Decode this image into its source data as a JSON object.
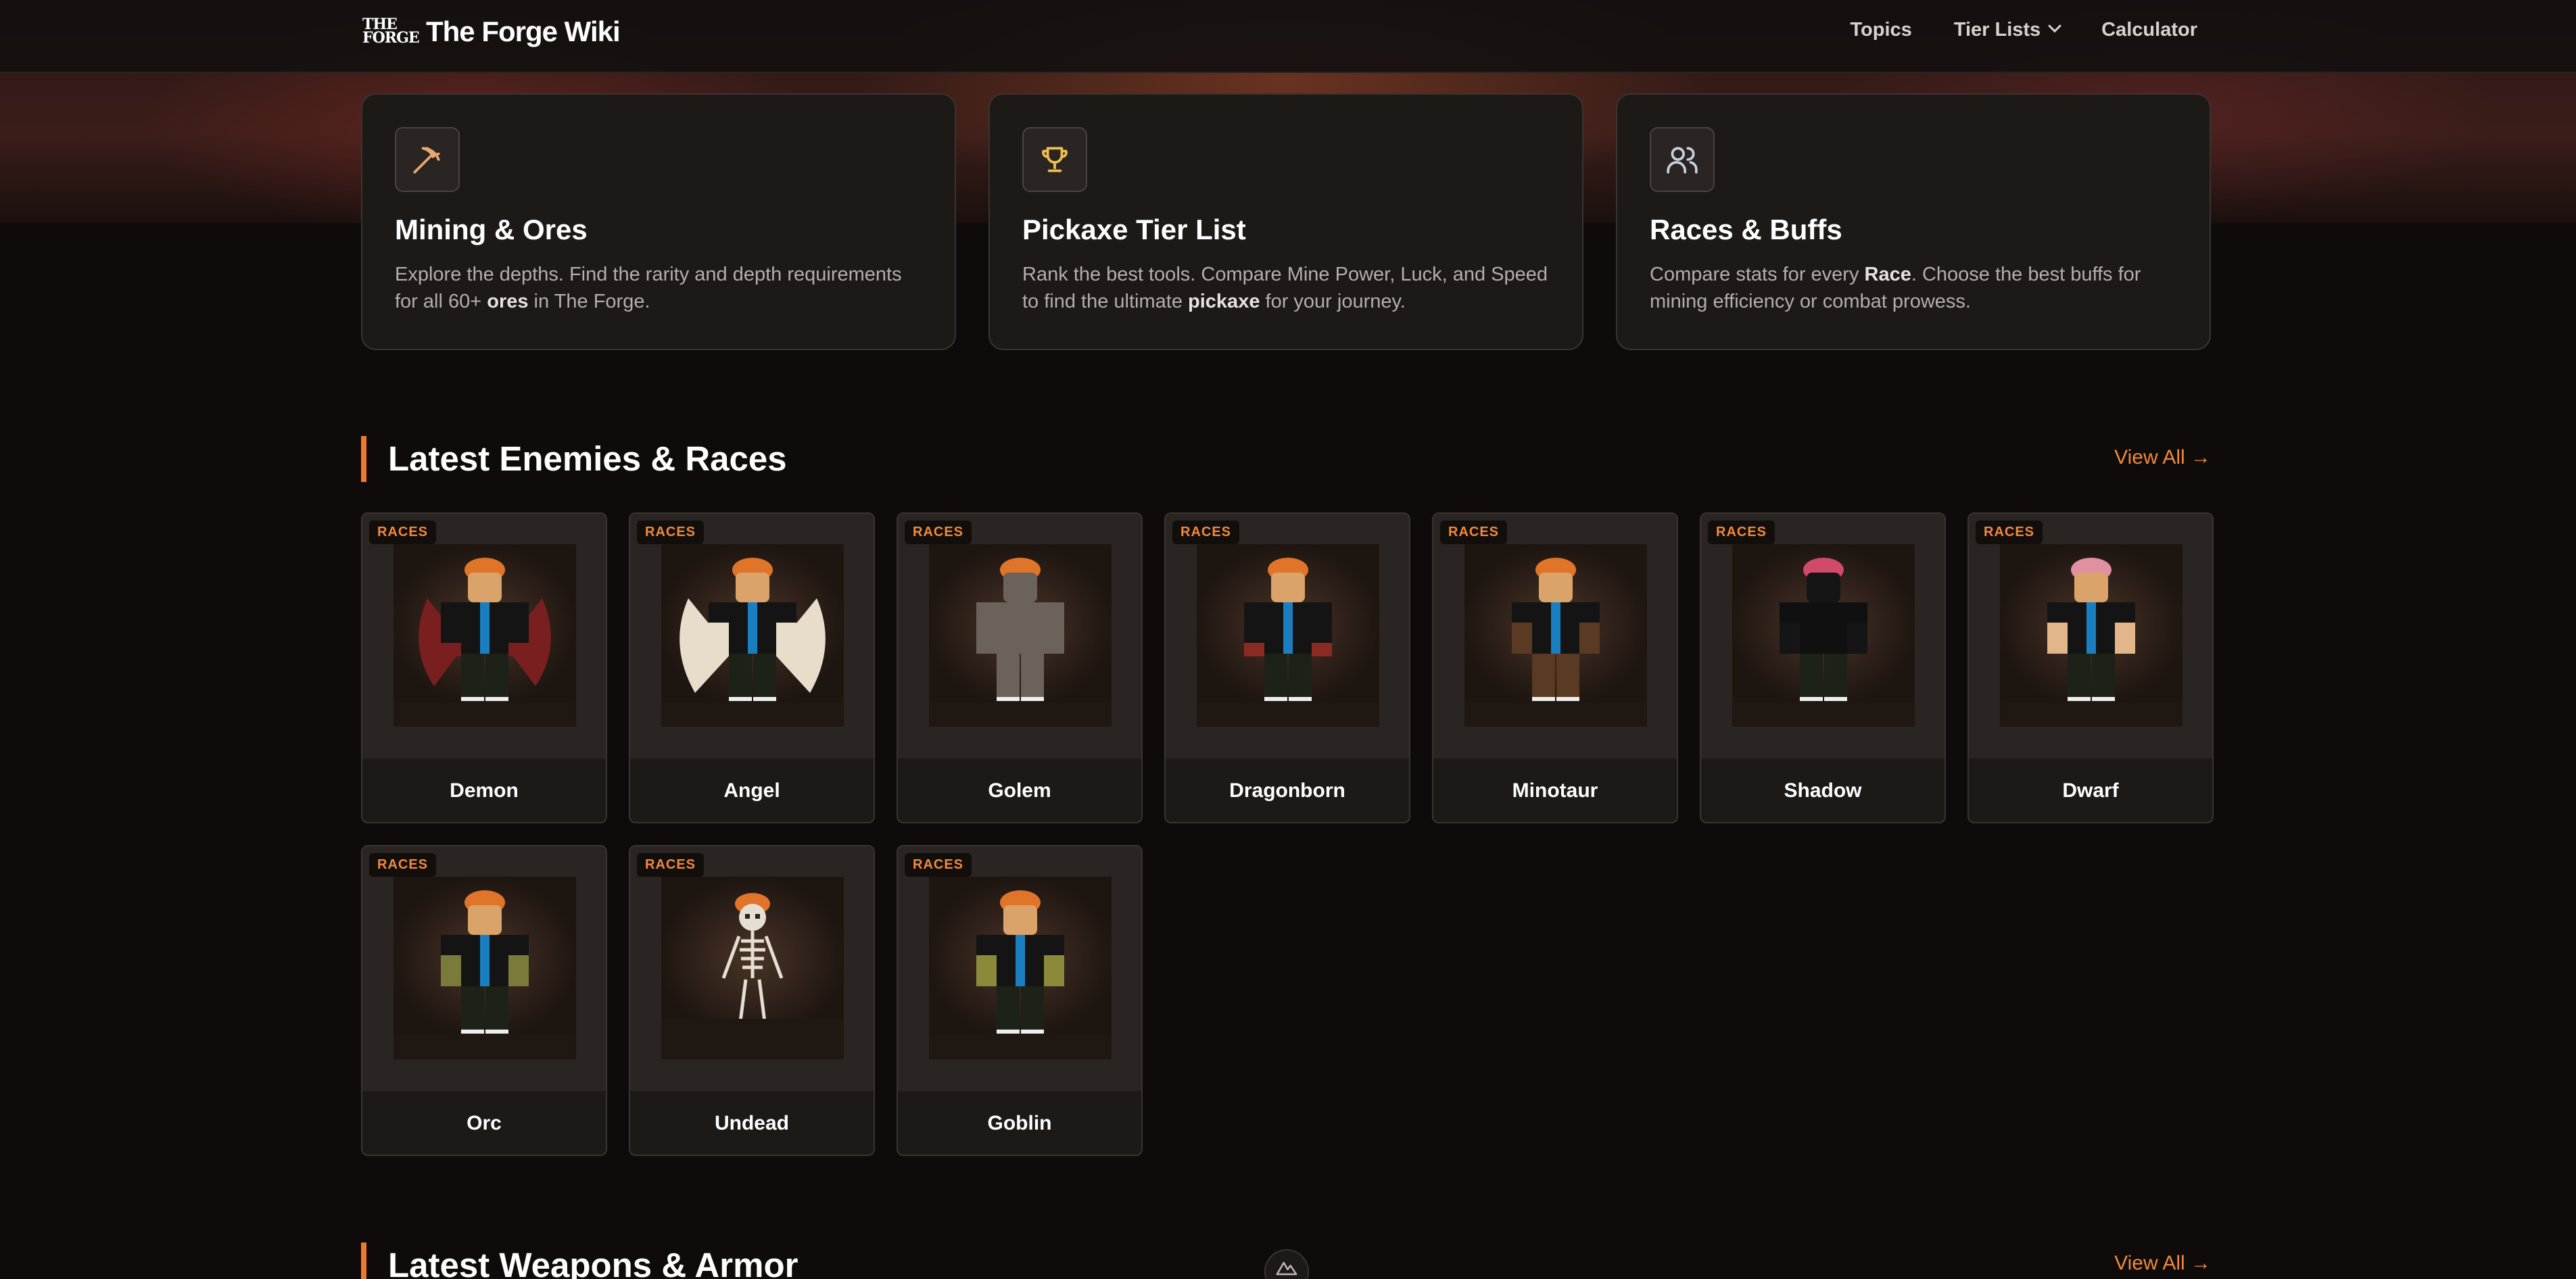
{
  "header": {
    "logo_mark_line1": "THE",
    "logo_mark_line2": "FORGE",
    "site_title": "The Forge Wiki",
    "nav": {
      "topics": "Topics",
      "tier_lists": "Tier Lists",
      "calculator": "Calculator"
    }
  },
  "features": [
    {
      "icon": "pickaxe-icon",
      "title": "Mining & Ores",
      "desc_before": "Explore the depths. Find the rarity and depth requirements for all 60+ ",
      "desc_bold": "ores",
      "desc_after": " in The Forge."
    },
    {
      "icon": "trophy-icon",
      "title": "Pickaxe Tier List",
      "desc_before": "Rank the best tools. Compare Mine Power, Luck, and Speed to find the ultimate ",
      "desc_bold": "pickaxe",
      "desc_after": " for your journey."
    },
    {
      "icon": "users-icon",
      "title": "Races & Buffs",
      "desc_before": "Compare stats for every ",
      "desc_bold": "Race",
      "desc_after": ". Choose the best buffs for mining efficiency or combat prowess."
    }
  ],
  "enemies_section": {
    "title": "Latest Enemies & Races",
    "view_all": "View All →",
    "badge": "RACES",
    "cards": [
      {
        "name": "Demon",
        "shirt": "#141414",
        "skin": "#6b2a2a",
        "hair": "#e0752a",
        "accent": "#7a1f1f"
      },
      {
        "name": "Angel",
        "shirt": "#141414",
        "skin": "#d9a36a",
        "hair": "#e0752a",
        "accent": "#e8dccb"
      },
      {
        "name": "Golem",
        "shirt": "#6b625a",
        "skin": "#6b625a",
        "hair": "#e0752a",
        "accent": "#6b625a"
      },
      {
        "name": "Dragonborn",
        "shirt": "#141414",
        "skin": "#8a2a22",
        "hair": "#e0752a",
        "accent": "#8a2a22"
      },
      {
        "name": "Minotaur",
        "shirt": "#141414",
        "skin": "#d9a36a",
        "hair": "#e0752a",
        "accent": "#5a3a22"
      },
      {
        "name": "Shadow",
        "shirt": "#101010",
        "skin": "#151515",
        "hair": "#d04a6a",
        "accent": "#151515"
      },
      {
        "name": "Dwarf",
        "shirt": "#141414",
        "skin": "#e3b58a",
        "hair": "#e090a0",
        "accent": "#e3b58a"
      },
      {
        "name": "Orc",
        "shirt": "#141414",
        "skin": "#7a7a3a",
        "hair": "#e0752a",
        "accent": "#7a7a3a"
      },
      {
        "name": "Undead",
        "shirt": "#d8d0c4",
        "skin": "#d8d0c4",
        "hair": "#e0752a",
        "accent": "#d8d0c4"
      },
      {
        "name": "Goblin",
        "shirt": "#141414",
        "skin": "#8a8a3a",
        "hair": "#e0752a",
        "accent": "#8a8a3a"
      }
    ]
  },
  "weapons_section": {
    "title": "Latest Weapons & Armor",
    "view_all": "View All →"
  },
  "colors": {
    "accent": "#f07a2a",
    "background": "#0e0b0a",
    "card": "#1d1917"
  }
}
